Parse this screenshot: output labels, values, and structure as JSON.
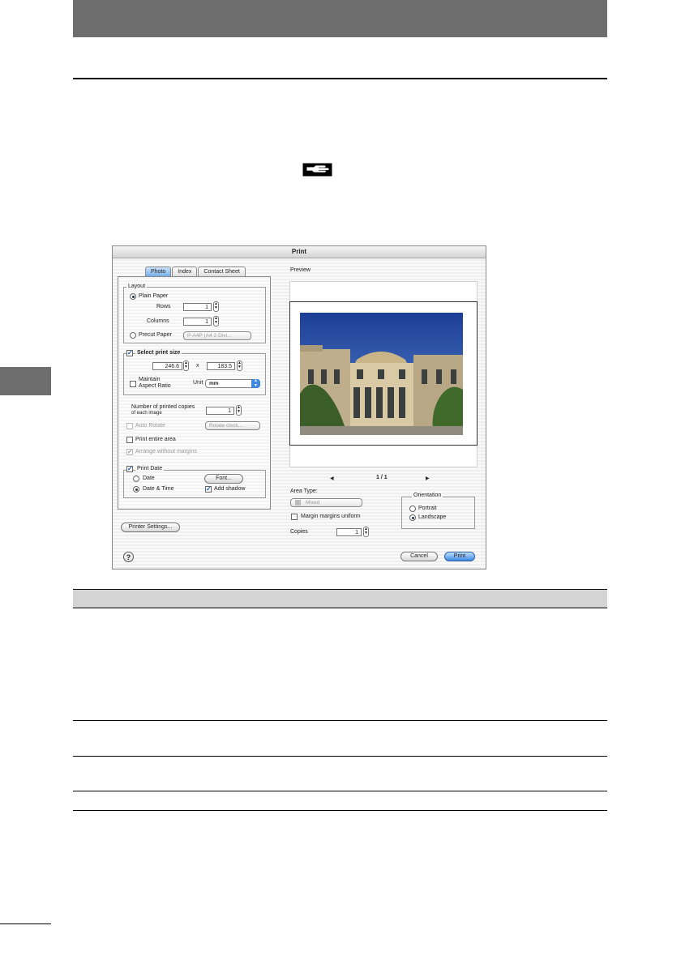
{
  "dialog": {
    "title": "Print",
    "tabs": [
      "Photo",
      "Index",
      "Contact Sheet"
    ],
    "preview_label": "Preview",
    "layout": {
      "legend": "Layout",
      "plain_paper": "Plain Paper",
      "rows_label": "Rows",
      "rows_value": "1",
      "columns_label": "Columns",
      "columns_value": "1",
      "precut_paper": "Precut Paper",
      "precut_value": "P-A4P (A4 2-Divi..."
    },
    "print_size": {
      "label": "Select print size",
      "width": "246.6",
      "times": "x",
      "height": "183.5",
      "maintain_aspect_line1": "Maintain",
      "maintain_aspect_line2": "Aspect Ratio",
      "unit_label": "Unit",
      "unit_value": "mm"
    },
    "copies_each": {
      "label_line1": "Number of printed copies",
      "label_line2": "of each image",
      "value": "1"
    },
    "auto_rotate": "Auto Rotate",
    "rotate_value": "Rotate clock...",
    "print_entire_area": "Print entire area",
    "arrange_without_margins": "Arrange without margins",
    "print_date": {
      "legend": "Print Date",
      "date": "Date",
      "date_time": "Date & Time",
      "font_button": "Font...",
      "add_shadow": "Add shadow"
    },
    "pager": {
      "prev": "◀",
      "text": "1 / 1",
      "next": "▶"
    },
    "area_type_label": "Area Type:",
    "area_type_value": "Mixed",
    "margin_uniform": "Margin margins uniform",
    "copies_label": "Copies",
    "copies_value": "1",
    "orientation": {
      "legend": "Orientation",
      "portrait": "Portrait",
      "landscape": "Landscape"
    },
    "printer_settings": "Printer Settings...",
    "help": "?",
    "cancel": "Cancel",
    "print": "Print"
  },
  "colors": {
    "header_bar": "#6e6e6e",
    "table_header": "#d4d4d4",
    "accent_blue": "#3f88e0"
  }
}
